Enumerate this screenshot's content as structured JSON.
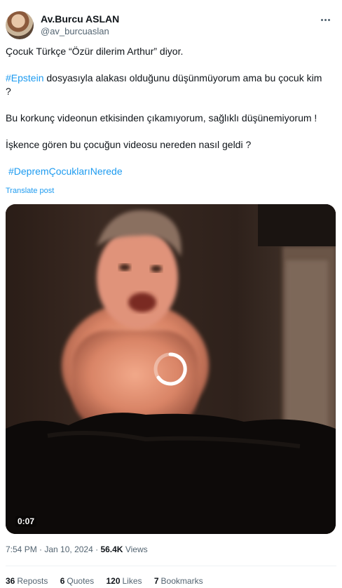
{
  "author": {
    "display_name": "Av.Burcu ASLAN",
    "handle": "@av_burcuaslan"
  },
  "post": {
    "line1": "Çocuk Türkçe “Özür dilerim Arthur” diyor.",
    "line2_hashtag": "#Epstein",
    "line2_text": " dosyasıyla alakası olduğunu düşünmüyorum ama bu çocuk kim",
    "line3": "?",
    "line4": "Bu korkunç videonun etkisinden çıkamıyorum, sağlıklı düşünemiyorum !",
    "line5": "İşkence gören bu çocuğun videosu nereden nasıl geldi ?",
    "line6_hashtag": "#DepremÇocuklarıNerede",
    "translate_label": "Translate post"
  },
  "video": {
    "duration": "0:07",
    "loading": true
  },
  "meta": {
    "time": "7:54 PM",
    "separator": " · ",
    "date": "Jan 10, 2024",
    "views_count": "56.4K",
    "views_label": " Views"
  },
  "stats": {
    "reposts_count": "36",
    "reposts_label": "Reposts",
    "quotes_count": "6",
    "quotes_label": "Quotes",
    "likes_count": "120",
    "likes_label": "Likes",
    "bookmarks_count": "7",
    "bookmarks_label": "Bookmarks"
  },
  "colors": {
    "link": "#1d9bf0",
    "secondary_text": "#536471",
    "primary_text": "#0f1419"
  },
  "icons": [
    "more-options-icon",
    "loading-spinner-icon"
  ]
}
